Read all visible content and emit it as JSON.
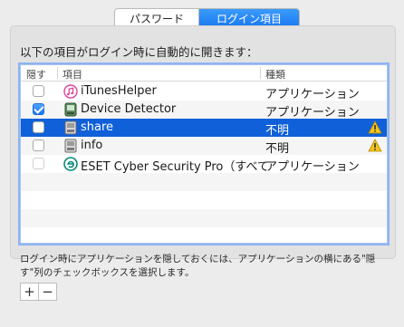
{
  "tabs": [
    {
      "label": "パスワード",
      "active": false
    },
    {
      "label": "ログイン項目",
      "active": true
    }
  ],
  "description": "以下の項目がログイン時に自動的に開きます：",
  "table": {
    "columns": [
      "隠す",
      "項目",
      "種類"
    ],
    "rows": [
      {
        "hide": false,
        "name": "iTunesHelper",
        "kind": "アプリケーション",
        "icon": "itunes-icon",
        "warning": false
      },
      {
        "hide": true,
        "name": "Device Detector",
        "kind": "アプリケーション",
        "icon": "app-generic-icon",
        "warning": false
      },
      {
        "hide": false,
        "name": "share",
        "kind": "不明",
        "icon": "hard-drive-icon",
        "warning": true,
        "selected": true
      },
      {
        "hide": false,
        "name": "info",
        "kind": "不明",
        "icon": "hard-drive-icon",
        "warning": true
      },
      {
        "hide": false,
        "name": "ESET Cyber Security Pro（すべて",
        "kind": "アプリケーション",
        "icon": "eset-icon",
        "warning": false
      }
    ]
  },
  "help_text": "ログイン時にアプリケーションを隠しておくには、アプリケーションの横にある\"隠す\"列のチェックボックスを選択します。",
  "buttons": {
    "add": "+",
    "remove": "−"
  },
  "colors": {
    "accent": "#1060d9",
    "warning": "#f5c518"
  }
}
